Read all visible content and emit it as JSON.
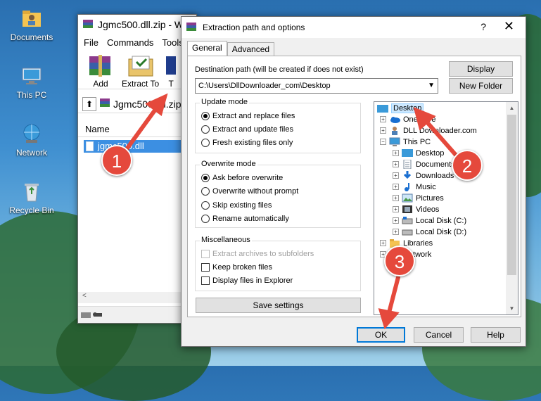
{
  "desktop": {
    "icons": [
      {
        "label": "Documents",
        "icon": "folder-user-icon"
      },
      {
        "label": "This PC",
        "icon": "computer-icon"
      },
      {
        "label": "Network",
        "icon": "network-icon"
      },
      {
        "label": "Recycle Bin",
        "icon": "recycle-bin-icon"
      }
    ]
  },
  "winrar": {
    "title": "Jgmc500.dll.zip - W",
    "menu": [
      "File",
      "Commands",
      "Tools"
    ],
    "toolbar": {
      "add": "Add",
      "extract_to": "Extract To",
      "test": "T"
    },
    "path": "Jgmc500.dll.zip",
    "column_name": "Name",
    "file": "jgmc500.dll"
  },
  "dialog": {
    "title": "Extraction path and options",
    "help_glyph": "?",
    "close_glyph": "✕",
    "tabs": [
      "General",
      "Advanced"
    ],
    "dest_label": "Destination path (will be created if does not exist)",
    "dest_value": "C:\\Users\\DllDownloader_com\\Desktop",
    "display_btn": "Display",
    "new_folder_btn": "New Folder",
    "update_mode": {
      "title": "Update mode",
      "options": [
        "Extract and replace files",
        "Extract and update files",
        "Fresh existing files only"
      ],
      "selected": 0
    },
    "overwrite_mode": {
      "title": "Overwrite mode",
      "options": [
        "Ask before overwrite",
        "Overwrite without prompt",
        "Skip existing files",
        "Rename automatically"
      ],
      "selected": 0
    },
    "misc": {
      "title": "Miscellaneous",
      "options": [
        "Extract archives to subfolders",
        "Keep broken files",
        "Display files in Explorer"
      ]
    },
    "save_settings": "Save settings",
    "tree": {
      "items": [
        {
          "label": "Desktop",
          "selected": true
        },
        {
          "label": "OneDrive"
        },
        {
          "label": "DLL Downloader.com"
        },
        {
          "label": "This PC"
        },
        {
          "label": "Desktop"
        },
        {
          "label": "Documents"
        },
        {
          "label": "Downloads"
        },
        {
          "label": "Music"
        },
        {
          "label": "Pictures"
        },
        {
          "label": "Videos"
        },
        {
          "label": "Local Disk (C:)"
        },
        {
          "label": "Local Disk (D:)"
        },
        {
          "label": "Libraries"
        },
        {
          "label": "Network"
        }
      ]
    },
    "ok": "OK",
    "cancel": "Cancel",
    "help": "Help"
  },
  "annotations": {
    "step1": "1",
    "step2": "2",
    "step3": "3",
    "color": "#e5493c"
  }
}
